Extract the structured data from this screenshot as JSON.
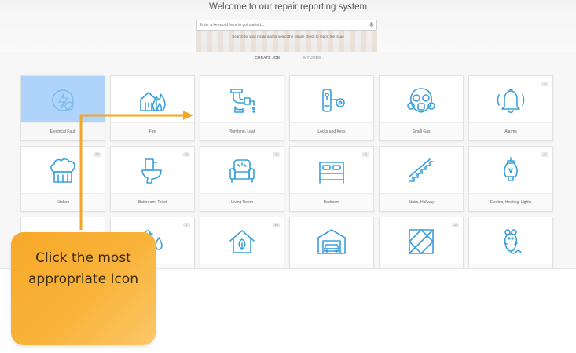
{
  "header": {
    "title": "Welcome to our repair reporting system",
    "search_placeholder": "Enter a keyword here to get started...",
    "hint": "Search for your repair and/or select the simple check to report the issue"
  },
  "tabs": [
    {
      "label": "CREATE JOB",
      "active": true
    },
    {
      "label": "MY JOBS",
      "active": false
    }
  ],
  "tiles": [
    {
      "label": "Electrical Fault",
      "icon": "electrical-fault-icon",
      "selected": true,
      "count": ""
    },
    {
      "label": "Fire",
      "icon": "fire-icon",
      "selected": false,
      "count": ""
    },
    {
      "label": "Plumbing, Leak",
      "icon": "plumbing-icon",
      "selected": false,
      "count": ""
    },
    {
      "label": "Locks and Keys",
      "icon": "lock-key-icon",
      "selected": false,
      "count": ""
    },
    {
      "label": "Smell Gas",
      "icon": "gas-mask-icon",
      "selected": false,
      "count": ""
    },
    {
      "label": "Alarms",
      "icon": "bell-icon",
      "selected": false,
      "count": "4"
    },
    {
      "label": "Kitchen",
      "icon": "chef-hat-icon",
      "selected": false,
      "count": "10"
    },
    {
      "label": "Bathroom, Toilet",
      "icon": "toilet-icon",
      "selected": false,
      "count": "5"
    },
    {
      "label": "Living Room",
      "icon": "armchair-icon",
      "selected": false,
      "count": "3"
    },
    {
      "label": "Bedroom",
      "icon": "bed-icon",
      "selected": false,
      "count": "3"
    },
    {
      "label": "Stairs, Hallway",
      "icon": "stairs-icon",
      "selected": false,
      "count": ""
    },
    {
      "label": "Electric, Heating, Lights",
      "icon": "lightbulb-icon",
      "selected": false,
      "count": "9"
    },
    {
      "label": "",
      "icon": "radiator-icon",
      "selected": false,
      "count": ""
    },
    {
      "label": "",
      "icon": "temperature-drop-icon",
      "selected": false,
      "count": "7"
    },
    {
      "label": "",
      "icon": "eco-house-icon",
      "selected": false,
      "count": "15"
    },
    {
      "label": "",
      "icon": "garage-car-icon",
      "selected": false,
      "count": ""
    },
    {
      "label": "",
      "icon": "floor-tiles-icon",
      "selected": false,
      "count": "2"
    },
    {
      "label": "",
      "icon": "mouse-pest-icon",
      "selected": false,
      "count": ""
    }
  ],
  "callout": {
    "text": "Click the most appropriate Icon"
  },
  "colors": {
    "icon_stroke": "#3aa0dc",
    "selected_tile": "#aed4fb",
    "arrow": "#f5a623",
    "callout": "#f9b33a"
  }
}
